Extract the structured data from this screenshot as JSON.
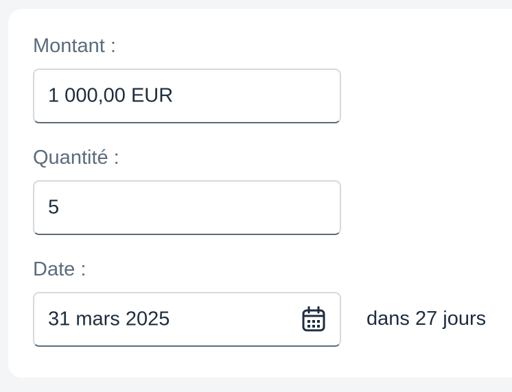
{
  "form": {
    "amount": {
      "label": "Montant :",
      "value": "1 000,00 EUR"
    },
    "quantity": {
      "label": "Quantité :",
      "value": "5"
    },
    "date": {
      "label": "Date :",
      "value": "31 mars 2025",
      "relative": "dans 27 jours",
      "icon": "calendar-icon"
    }
  },
  "colors": {
    "background": "#f4f5f7",
    "card": "#ffffff",
    "label": "#5b6b7c",
    "text": "#1d2d3e",
    "input_border": "#d5d9de",
    "input_bottom_border": "#5b6b7c"
  }
}
